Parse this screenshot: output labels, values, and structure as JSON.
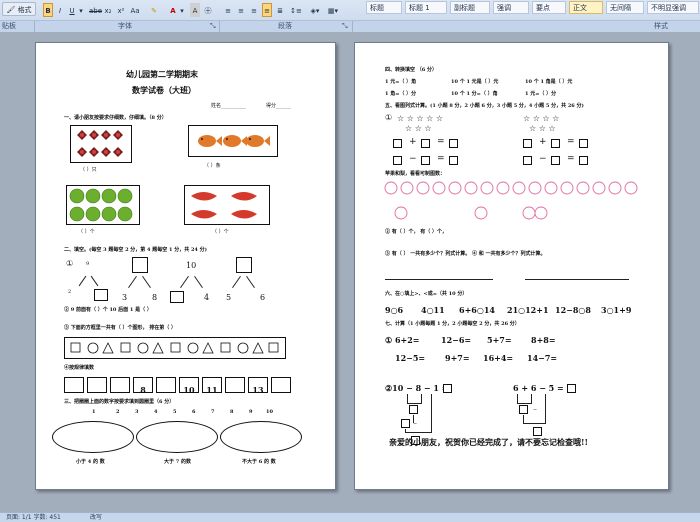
{
  "ribbon": {
    "format_painter": "格式刷",
    "styles": [
      "标题",
      "标题 1",
      "副标题",
      "强调",
      "要点",
      "正文",
      "无间隔",
      "不明显强调"
    ],
    "groups": {
      "clipboard": "贴板",
      "font": "字体",
      "paragraph": "段落",
      "styles": "样式"
    }
  },
  "page1": {
    "title": "幼儿园第二学期期末",
    "subtitle": "数学试卷（大班）",
    "name_label": "姓名__________",
    "score_label": "得分______",
    "q1_title": "一、请小朋友按要求仔细数，仔细填。（8 分）",
    "q1_a": "（      ）只",
    "q1_b": "（      ）条",
    "q1_c": "（      ）个",
    "q1_d": "（      ）个",
    "q2_title": "二、填空。(每空 3 题每空 2 分，第 4 题每空 1 分，共 24 分)",
    "tree1": {
      "label": "①",
      "top": "9",
      "left": "2",
      "right": ""
    },
    "tree2": {
      "top": "",
      "left": "3",
      "right": "8"
    },
    "tree3": {
      "top": "10",
      "left": "",
      "right": "4"
    },
    "tree4": {
      "top": "",
      "left": "5",
      "right": "6"
    },
    "q2_2": "② 9 前面有（      ）个          10 后面 1 是（      ）",
    "q2_3": "③  下面的方框里一共有（      ）个图形，        排在第（      ）",
    "q2_4": "④按规律填数",
    "seq_numbers": [
      "8",
      "10",
      "11",
      "13"
    ],
    "q3_title": "三、把圈圈上面的数字按要求填到圆圈里（6 分）",
    "nums_row": [
      "1",
      "2",
      "3",
      "4",
      "5",
      "6",
      "7",
      "8",
      "9",
      "10"
    ],
    "oval_labels": [
      "小于 4 的 数",
      "大于 7 的数",
      "不大于 6 的 数"
    ]
  },
  "page2": {
    "q4_title": "四、转换填空   （6 分）",
    "money1": "1 元=（      ）角",
    "money2": "10 个 1 元是（      ）元",
    "money3": "10 个 1 角是（      ）元",
    "money4": "1 角=（      ）分",
    "money5": "10 个 1 分=（      ）角",
    "money6": "1 元=（      ）分",
    "q5_title": "五、看图列式计算。(1 小题 8 分，2 小题 6 分，3 小题 5 分，4 小题 5 分，共 26 分)",
    "q5_1": "①",
    "apple_title": "苹果和梨，看看可制图数：",
    "q5_3a": "②        有（      ）个，        有（      ）个，",
    "q5_3b": "③        有（      ）        一共有多少个？列式计算。    ④        和        一共有多少个？列式计算。",
    "q6_title": "六、在○填上>、<或=（共 10 分）",
    "compare": [
      "9○6",
      "4○11",
      "6+6○14",
      "21○12+1",
      "12−8○8",
      "3○1+9"
    ],
    "q7_title": "七、计算（1 小题每题 1 分，2 小题每空 2 分，共 26 分）",
    "calc_row1": [
      "① 6+2=",
      "12−6=",
      "5+7=",
      "8+8="
    ],
    "calc_row2": [
      "12−5=",
      "9+7=",
      "16+4=",
      "14−7="
    ],
    "q7_2a": "②10 − 8 − 1 =",
    "q7_2b": "6 + 6 − 5 =",
    "closing": "亲爱的小朋友，祝贺你已经完成了，请不要忘记检查哦!!"
  },
  "status": {
    "left": "页面: 1/1    字数: 451",
    "right": "改写"
  }
}
